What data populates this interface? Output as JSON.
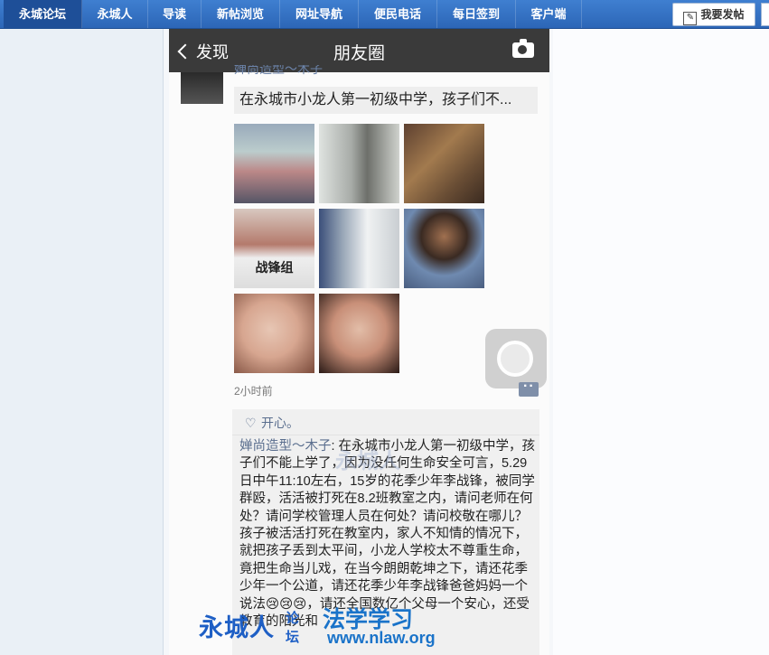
{
  "nav": {
    "items": [
      {
        "label": "永城论坛",
        "active": true
      },
      {
        "label": "永城人",
        "active": false
      },
      {
        "label": "导读",
        "active": false
      },
      {
        "label": "新帖浏览",
        "active": false
      },
      {
        "label": "网址导航",
        "active": false
      },
      {
        "label": "便民电话",
        "active": false
      },
      {
        "label": "每日签到",
        "active": false
      },
      {
        "label": "客户端",
        "active": false
      }
    ],
    "post_button": "我要发帖"
  },
  "wechat": {
    "back_label": "发现",
    "title": "朋友圈",
    "camera_icon": "camera-icon",
    "author_cut": "婵尚造型～木子",
    "post_preview": "在永城市小龙人第一初级中学，孩子们不...",
    "thumb_caption": "战锋组",
    "time": "2小时前",
    "like_names": "开心。",
    "comment_author": "婵尚造型～木子",
    "comment_body": ": 在永城市小龙人第一初级中学，孩子们不能上学了，因为没任何生命安全可言，5.29日中午11:10左右，15岁的花季少年李战锋，被同学群殴，活活被打死在8.2班教室之内，请问老师在何处？请问学校管理人员在何处？请问校敬在哪儿？孩子被活活打死在教室内，家人不知情的情况下，就把孩子丢到太平间，小龙人学校太不尊重生命，竟把生命当儿戏，在当今朗朗乾坤之下，请还花季少年一个公道，请还花季少年李战锋爸爸妈妈一个说法😢😢😢，请还全国数亿个父母一个安心，还受教育的阳光和"
  },
  "watermark": {
    "brand": "永城人",
    "sub": "论坛",
    "site": "法学学习",
    "url": "www.nlaw.org",
    "mid": "永城人"
  },
  "colors": {
    "nav_bg": "#2c66b7",
    "link": "#5a6e8e",
    "header": "#3a3a3a"
  }
}
